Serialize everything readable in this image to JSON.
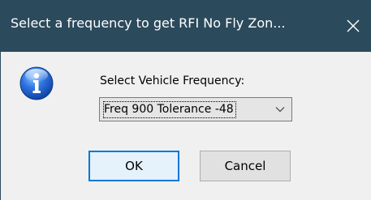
{
  "dialog": {
    "title": "Select a frequency to get RFI No Fly Zon...",
    "close_glyph": "✕",
    "icon": "info-icon",
    "prompt": "Select Vehicle Frequency:",
    "frequency_select": {
      "value": "Freq 900 Tolerance -48"
    },
    "ok_label": "OK",
    "cancel_label": "Cancel"
  },
  "colors": {
    "titlebar": "#2b4a5c",
    "accent": "#0078d7",
    "background": "#f0f0f0"
  }
}
